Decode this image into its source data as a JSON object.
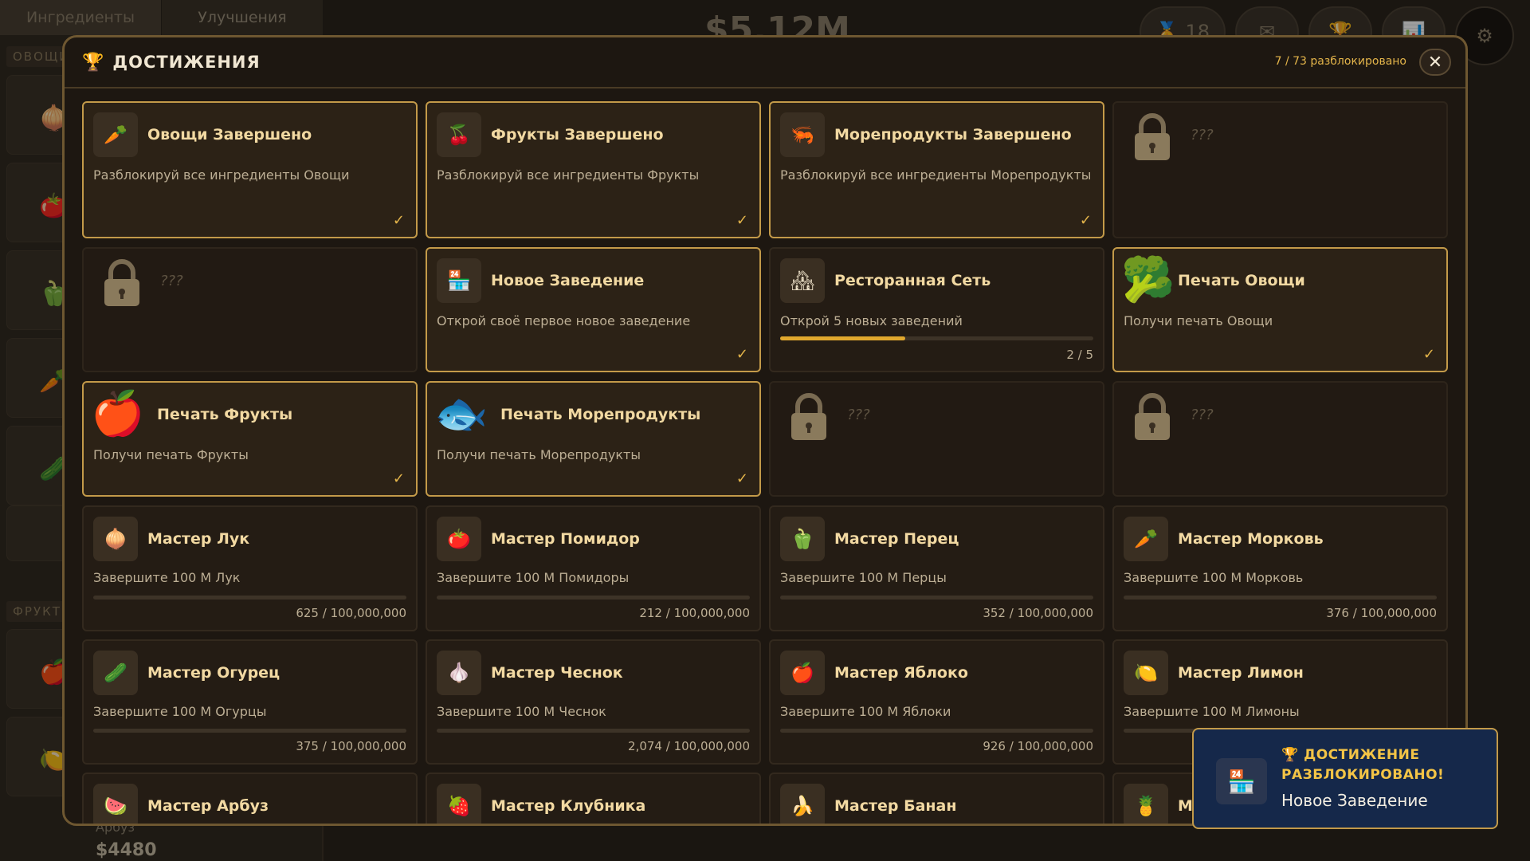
{
  "background": {
    "tabs": [
      {
        "label": "Ингредиенты"
      },
      {
        "label": "Улучшения"
      }
    ],
    "sections": [
      "ОВОЩИ",
      "ФРУКТЫ"
    ],
    "money": "$5.12M",
    "badge_count": "18",
    "bottom_item": {
      "name": "Арбуз",
      "price": "$4480"
    }
  },
  "modal": {
    "title": "ДОСТИЖЕНИЯ",
    "unlocked_count": "7 / 73 разблокировано",
    "close_label": "✕"
  },
  "achievements": [
    {
      "title": "Овощи Завершено",
      "desc": "Разблокируй все ингредиенты Овощи",
      "status": "done",
      "icon": "vegetables-icon"
    },
    {
      "title": "Фрукты Завершено",
      "desc": "Разблокируй все ингредиенты Фрукты",
      "status": "done",
      "icon": "fruits-icon"
    },
    {
      "title": "Морепродукты Завершено",
      "desc": "Разблокируй все ингредиенты Морепродукты",
      "status": "done",
      "icon": "seafood-icon"
    },
    {
      "title": "???",
      "status": "locked",
      "icon": "lock-icon"
    },
    {
      "title": "???",
      "status": "locked",
      "icon": "lock-icon"
    },
    {
      "title": "Новое Заведение",
      "desc": "Открой своё первое новое заведение",
      "status": "done",
      "icon": "restaurant-icon"
    },
    {
      "title": "Ресторанная Сеть",
      "desc": "Открой 5 новых заведений",
      "status": "progress",
      "progress_text": "2 / 5",
      "progress": 0.4,
      "icon": "restaurant-chain-icon"
    },
    {
      "title": "Печать Овощи",
      "desc": "Получи печать Овощи",
      "status": "done",
      "icon": "broccoli-icon"
    },
    {
      "title": "Печать Фрукты",
      "desc": "Получи печать Фрукты",
      "status": "done",
      "icon": "apple-icon"
    },
    {
      "title": "Печать Морепродукты",
      "desc": "Получи печать Морепродукты",
      "status": "done",
      "icon": "fish-icon"
    },
    {
      "title": "???",
      "status": "locked",
      "icon": "lock-icon"
    },
    {
      "title": "???",
      "status": "locked",
      "icon": "lock-icon"
    },
    {
      "title": "Мастер Лук",
      "desc": "Завершите 100 М Лук",
      "progress_text": "625 / 100,000,000",
      "progress": 6.25e-06,
      "icon": "onion-icon"
    },
    {
      "title": "Мастер Помидор",
      "desc": "Завершите 100 М Помидоры",
      "progress_text": "212 / 100,000,000",
      "progress": 2.12e-06,
      "icon": "tomato-icon"
    },
    {
      "title": "Мастер Перец",
      "desc": "Завершите 100 М Перцы",
      "progress_text": "352 / 100,000,000",
      "progress": 3.52e-06,
      "icon": "pepper-icon"
    },
    {
      "title": "Мастер Морковь",
      "desc": "Завершите 100 М Морковь",
      "progress_text": "376 / 100,000,000",
      "progress": 3.76e-06,
      "icon": "carrot-icon"
    },
    {
      "title": "Мастер Огурец",
      "desc": "Завершите 100 М Огурцы",
      "progress_text": "375 / 100,000,000",
      "progress": 3.75e-06,
      "icon": "cucumber-icon"
    },
    {
      "title": "Мастер Чеснок",
      "desc": "Завершите 100 М Чеснок",
      "progress_text": "2,074 / 100,000,000",
      "progress": 2.074e-05,
      "icon": "garlic-icon"
    },
    {
      "title": "Мастер Яблоко",
      "desc": "Завершите 100 М Яблоки",
      "progress_text": "926 / 100,000,000",
      "progress": 9.26e-06,
      "icon": "apple-icon"
    },
    {
      "title": "Мастер Лимон",
      "desc": "Завершите 100 М Лимоны",
      "icon": "lemon-icon"
    },
    {
      "title": "Мастер Арбуз",
      "icon": "watermelon-icon"
    },
    {
      "title": "Мастер Клубника",
      "icon": "strawberry-icon"
    },
    {
      "title": "Мастер Банан",
      "icon": "banana-icon"
    },
    {
      "title": "Ма",
      "icon": "pineapple-icon"
    }
  ],
  "toast": {
    "heading": "ДОСТИЖЕНИЕ РАЗБЛОКИРОВАНО!",
    "name": "Новое Заведение"
  }
}
